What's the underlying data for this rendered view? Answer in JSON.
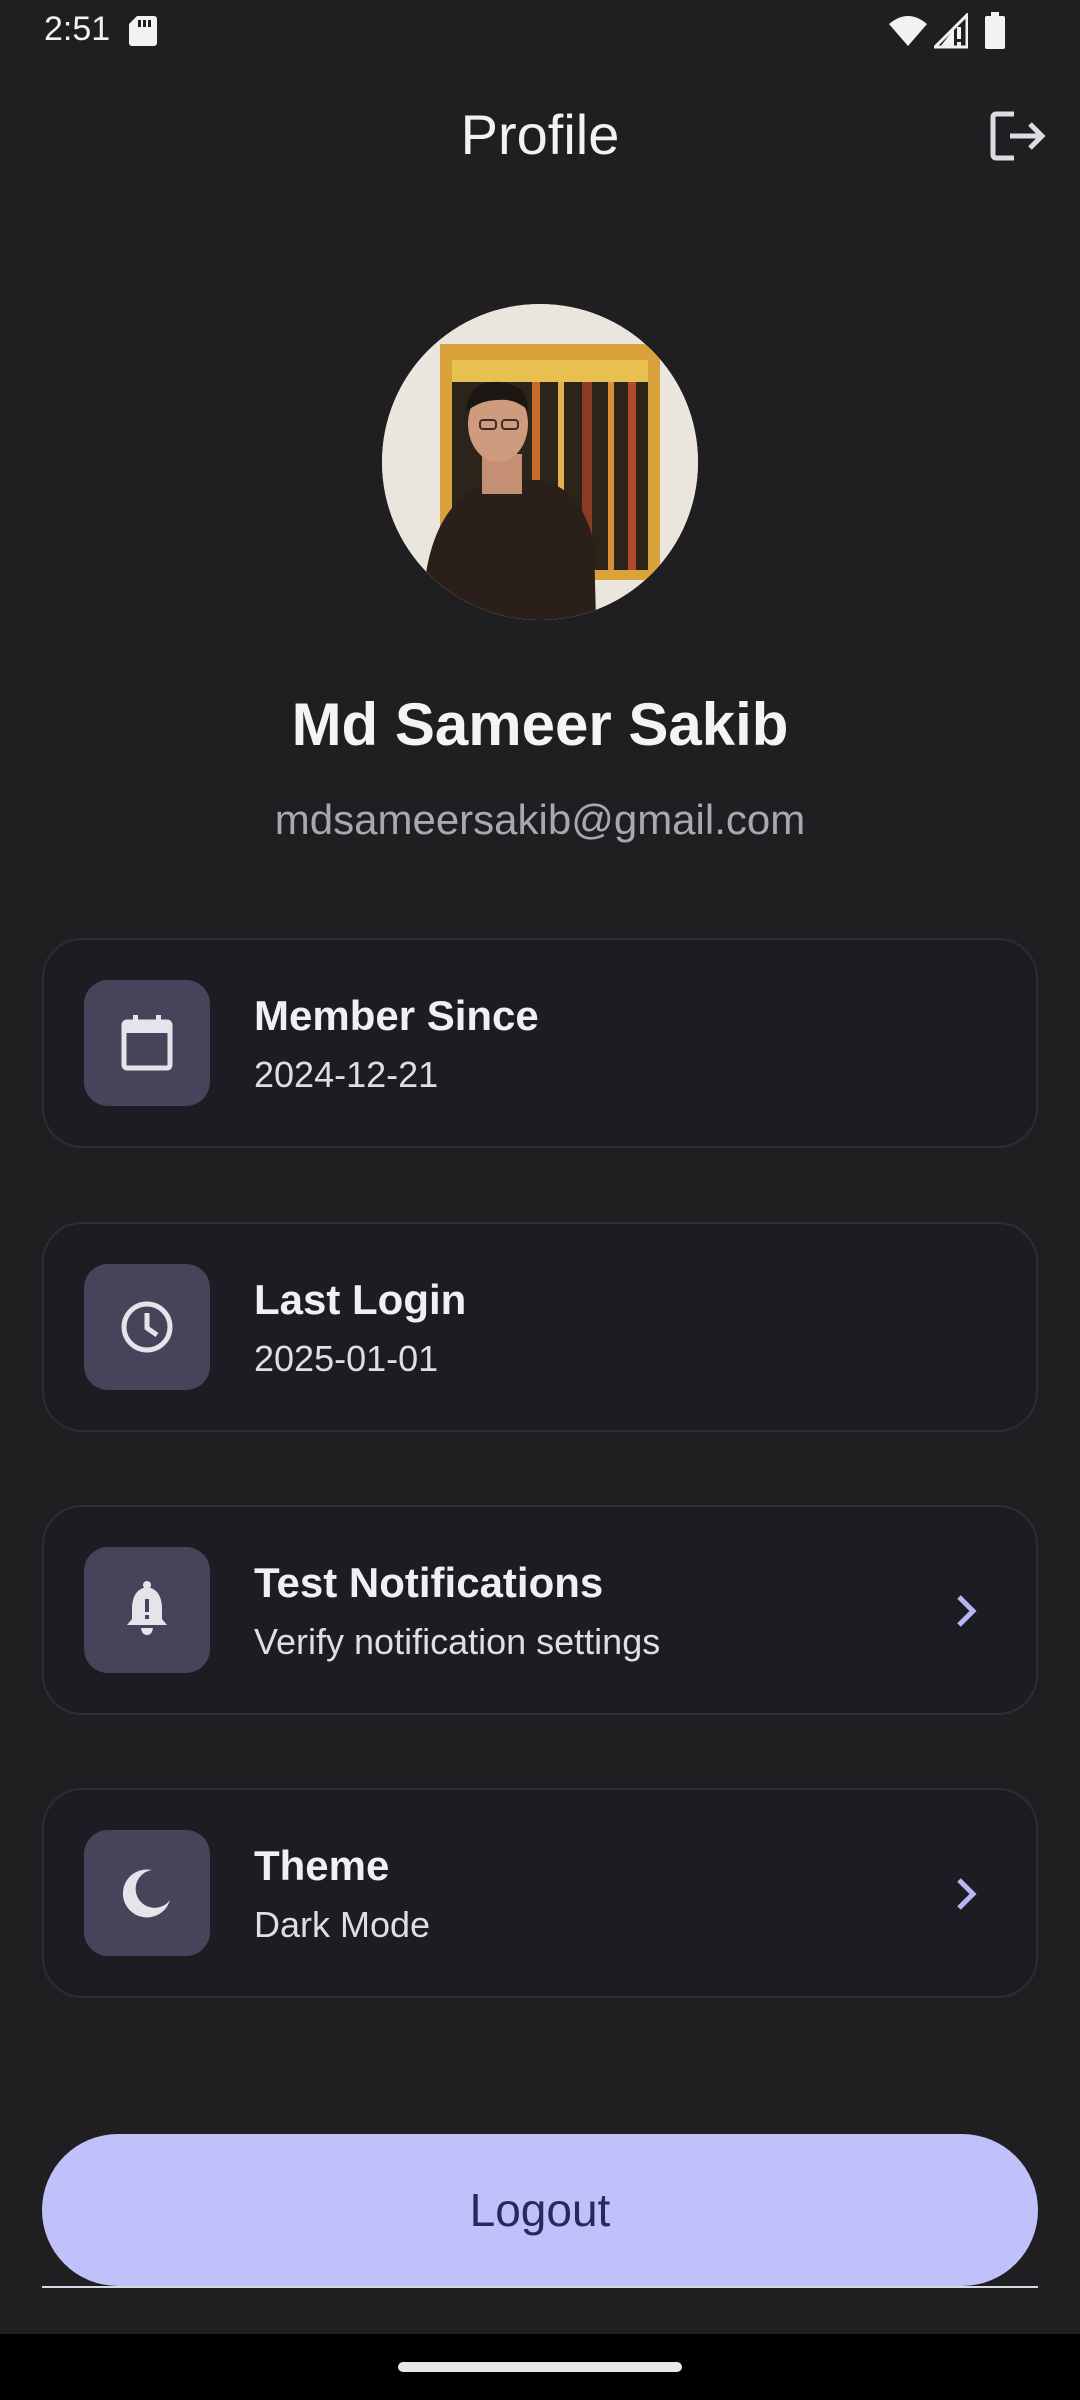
{
  "status_bar": {
    "time": "2:51",
    "icons": [
      "sd-card-icon",
      "wifi-icon",
      "signal-icon",
      "battery-icon"
    ]
  },
  "header": {
    "title": "Profile",
    "action_icon": "logout-icon"
  },
  "profile": {
    "name": "Md Sameer Sakib",
    "email": "mdsameersakib@gmail.com"
  },
  "cards": [
    {
      "icon": "calendar-icon",
      "title": "Member Since",
      "subtitle": "2024-12-21",
      "has_chevron": false
    },
    {
      "icon": "clock-icon",
      "title": "Last Login",
      "subtitle": "2025-01-01",
      "has_chevron": false
    },
    {
      "icon": "bell-icon",
      "title": "Test Notifications",
      "subtitle": "Verify notification settings",
      "has_chevron": true
    },
    {
      "icon": "moon-icon",
      "title": "Theme",
      "subtitle": "Dark Mode",
      "has_chevron": true
    }
  ],
  "logout_button": {
    "label": "Logout"
  },
  "colors": {
    "background": "#1f1f21",
    "card": "#1d1c22",
    "icon_box": "#45445a",
    "accent": "#c0c1fb",
    "chevron": "#b4b6f5"
  }
}
